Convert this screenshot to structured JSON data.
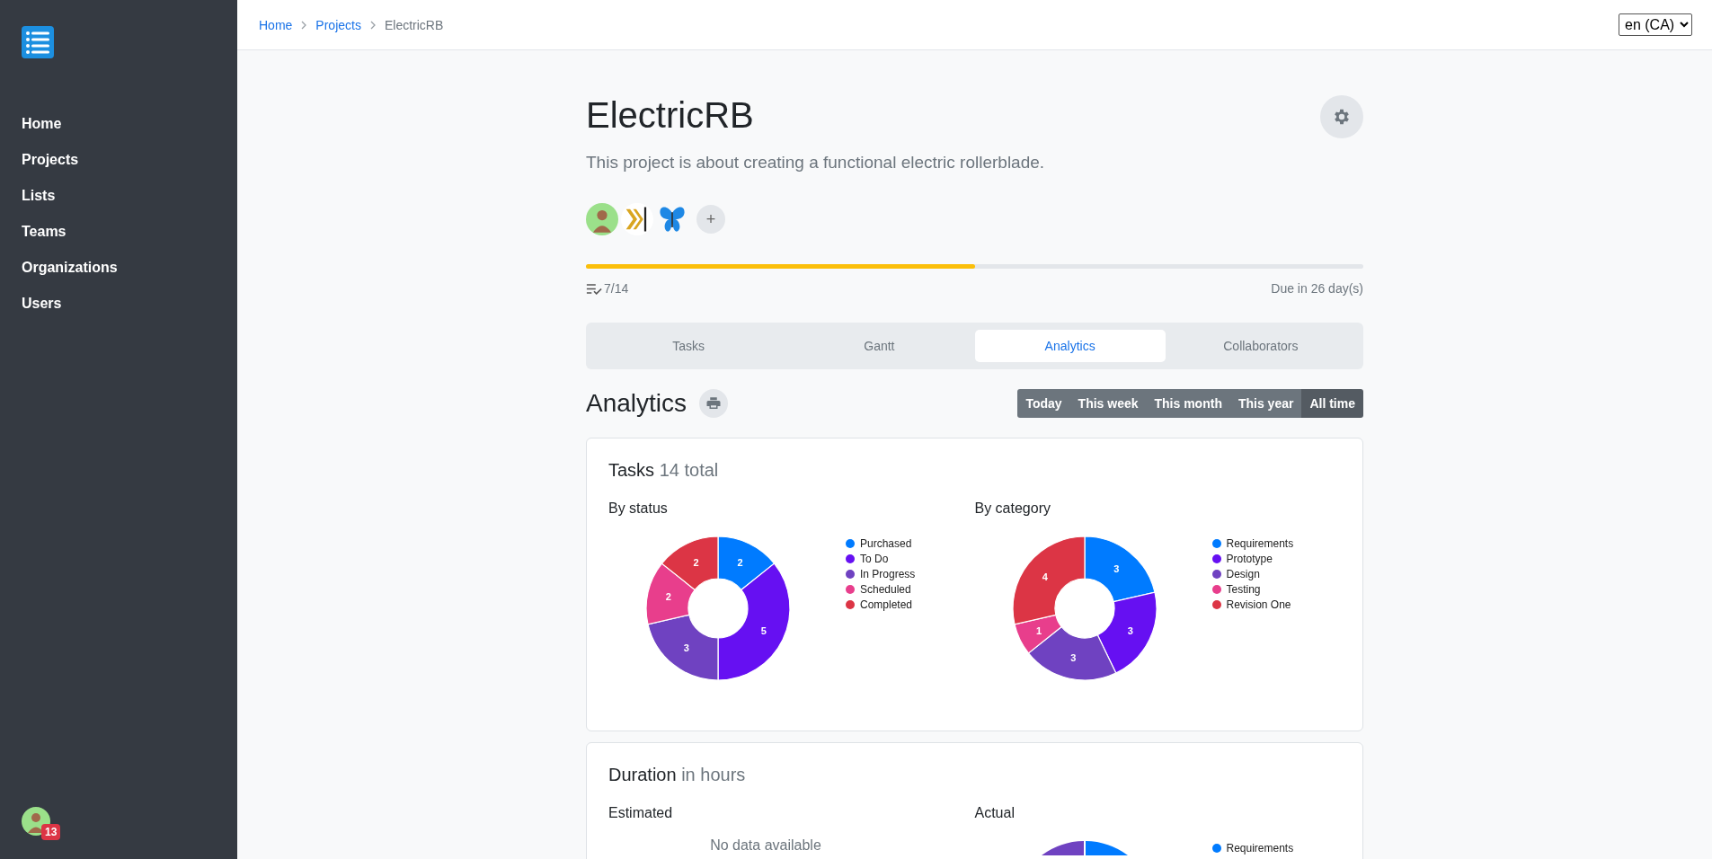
{
  "sidebar": {
    "items": [
      {
        "label": "Home"
      },
      {
        "label": "Projects"
      },
      {
        "label": "Lists"
      },
      {
        "label": "Teams"
      },
      {
        "label": "Organizations"
      },
      {
        "label": "Users"
      }
    ],
    "user": {
      "badge": "13"
    }
  },
  "breadcrumb": [
    {
      "label": "Home",
      "kind": "link"
    },
    {
      "label": "Projects",
      "kind": "link"
    },
    {
      "label": "ElectricRB",
      "kind": "current"
    }
  ],
  "language": {
    "value": "en (CA)"
  },
  "project": {
    "title": "ElectricRB",
    "description": "This project is about creating a functional electric rollerblade.",
    "add_member": "+",
    "progress": {
      "level": 0.5,
      "count": "7/14",
      "due": "Due in 26 day(s)"
    }
  },
  "tabs": [
    {
      "label": "Tasks",
      "selected": false
    },
    {
      "label": "Gantt",
      "selected": false
    },
    {
      "label": "Analytics",
      "selected": true
    },
    {
      "label": "Collaborators",
      "selected": false
    }
  ],
  "analytics": {
    "title": "Analytics",
    "ranges": [
      {
        "label": "Today",
        "selected": false
      },
      {
        "label": "This week",
        "selected": false
      },
      {
        "label": "This month",
        "selected": false
      },
      {
        "label": "This year",
        "selected": false
      },
      {
        "label": "All time",
        "selected": true
      }
    ]
  },
  "tasks_card": {
    "title": "Tasks",
    "subtitle": "14 total",
    "charts": [
      {
        "heading": "By status",
        "chart_data": {
          "type": "donut",
          "categories": [
            "Purchased",
            "To Do",
            "In Progress",
            "Scheduled",
            "Completed"
          ],
          "values": [
            2,
            5,
            3,
            2,
            2
          ],
          "data_labels": true,
          "legend": "right"
        }
      },
      {
        "heading": "By category",
        "chart_data": {
          "type": "donut",
          "categories": [
            "Requirements",
            "Prototype",
            "Design",
            "Testing",
            "Revision One"
          ],
          "values": [
            3,
            3,
            3,
            1,
            4
          ],
          "data_labels": true,
          "legend": "right"
        }
      }
    ]
  },
  "duration_card": {
    "title": "Duration",
    "subtitle": "in hours",
    "estimated": {
      "heading": "Estimated",
      "empty": "No data available"
    },
    "actual": {
      "heading": "Actual",
      "legend": [
        "Requirements"
      ]
    }
  }
}
